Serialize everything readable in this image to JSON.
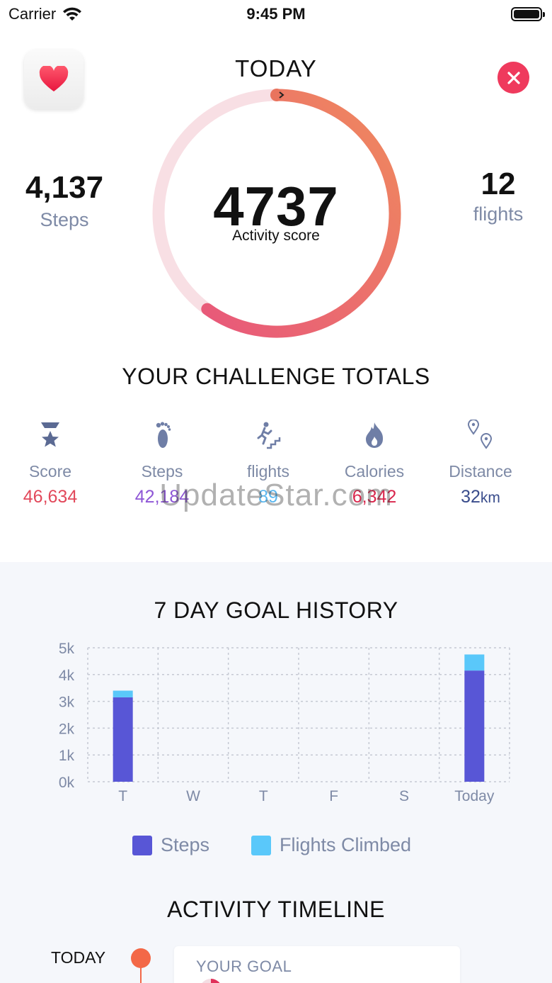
{
  "status_bar": {
    "carrier": "Carrier",
    "time": "9:45 PM"
  },
  "header": {
    "title": "TODAY"
  },
  "activity": {
    "score": "4737",
    "score_label": "Activity score",
    "ring_progress": 0.6,
    "steps_value": "4,137",
    "steps_label": "Steps",
    "flights_value": "12",
    "flights_label": "flights"
  },
  "challenge": {
    "title": "YOUR CHALLENGE TOTALS",
    "items": [
      {
        "label": "Score",
        "value": "46,634",
        "icon": "trophy-icon",
        "color": "#e2495b"
      },
      {
        "label": "Steps",
        "value": "42,184",
        "icon": "footprint-icon",
        "color": "#8e56d6"
      },
      {
        "label": "flights",
        "value": "89",
        "icon": "stairs-runner-icon",
        "color": "#5ab6ee"
      },
      {
        "label": "Calories",
        "value": "6,342",
        "icon": "flame-icon",
        "color": "#d9264c"
      },
      {
        "label": "Distance",
        "value": "32",
        "unit": "km",
        "icon": "map-pins-icon",
        "color": "#3a4d8c"
      }
    ]
  },
  "watermark": "UpdateStar.com",
  "goal_history": {
    "title": "7 DAY GOAL HISTORY"
  },
  "chart_data": {
    "type": "bar",
    "stacked": true,
    "categories": [
      "T",
      "W",
      "T",
      "F",
      "S",
      "Today"
    ],
    "series": [
      {
        "name": "Steps",
        "values": [
          3150,
          0,
          0,
          0,
          0,
          4150
        ],
        "color": "#5856d6"
      },
      {
        "name": "Flights Climbed",
        "values": [
          250,
          0,
          0,
          0,
          0,
          600
        ],
        "color": "#5ac8fa"
      }
    ],
    "y_ticks": [
      "0k",
      "1k",
      "2k",
      "3k",
      "4k",
      "5k"
    ],
    "ylim": [
      0,
      5000
    ],
    "grid": true,
    "legend_position": "bottom"
  },
  "timeline": {
    "title": "ACTIVITY TIMELINE",
    "today_label": "TODAY",
    "goal_label": "YOUR GOAL"
  }
}
